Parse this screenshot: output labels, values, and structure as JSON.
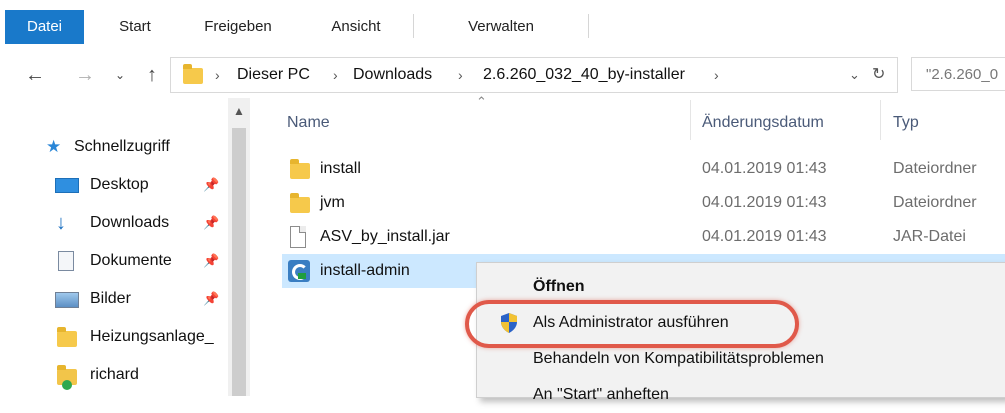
{
  "ribbon": {
    "tabs": [
      {
        "label": "Datei"
      },
      {
        "label": "Start"
      },
      {
        "label": "Freigeben"
      },
      {
        "label": "Ansicht"
      },
      {
        "label": "Verwalten"
      }
    ]
  },
  "address_bar": {
    "path": [
      "Dieser PC",
      "Downloads",
      "2.6.260_032_40_by-installer"
    ],
    "search_placeholder": "\"2.6.260_0"
  },
  "sidebar": {
    "items": [
      {
        "label": "Schnellzugriff",
        "icon": "star-icon"
      },
      {
        "label": "Desktop",
        "icon": "desktop-icon",
        "pinned": true
      },
      {
        "label": "Downloads",
        "icon": "download-arrow-icon",
        "pinned": true
      },
      {
        "label": "Dokumente",
        "icon": "document-icon",
        "pinned": true
      },
      {
        "label": "Bilder",
        "icon": "pictures-icon",
        "pinned": true
      },
      {
        "label": "Heizungsanlage_",
        "icon": "folder-icon"
      },
      {
        "label": "richard",
        "icon": "user-folder-icon"
      }
    ]
  },
  "file_list": {
    "columns": {
      "name": "Name",
      "date": "Änderungsdatum",
      "type": "Typ"
    },
    "rows": [
      {
        "name": "install",
        "date": "04.01.2019 01:43",
        "type": "Dateiordner",
        "icon": "folder-icon"
      },
      {
        "name": "jvm",
        "date": "04.01.2019 01:43",
        "type": "Dateiordner",
        "icon": "folder-icon"
      },
      {
        "name": "ASV_by_install.jar",
        "date": "04.01.2019 01:43",
        "type": "JAR-Datei",
        "icon": "file-icon"
      },
      {
        "name": "install-admin",
        "date": "",
        "type": "",
        "icon": "script-icon",
        "selected": true
      }
    ]
  },
  "context_menu": {
    "items": [
      {
        "label": "Öffnen",
        "default": true
      },
      {
        "label": "Als Administrator ausführen",
        "icon": "uac-shield-icon",
        "highlighted": true
      },
      {
        "label": "Behandeln von Kompatibilitätsproblemen"
      },
      {
        "label": "An \"Start\" anheften"
      }
    ]
  },
  "colors": {
    "accent": "#1979ca",
    "selection": "#cce8ff",
    "highlight_ring": "#e0594a"
  }
}
